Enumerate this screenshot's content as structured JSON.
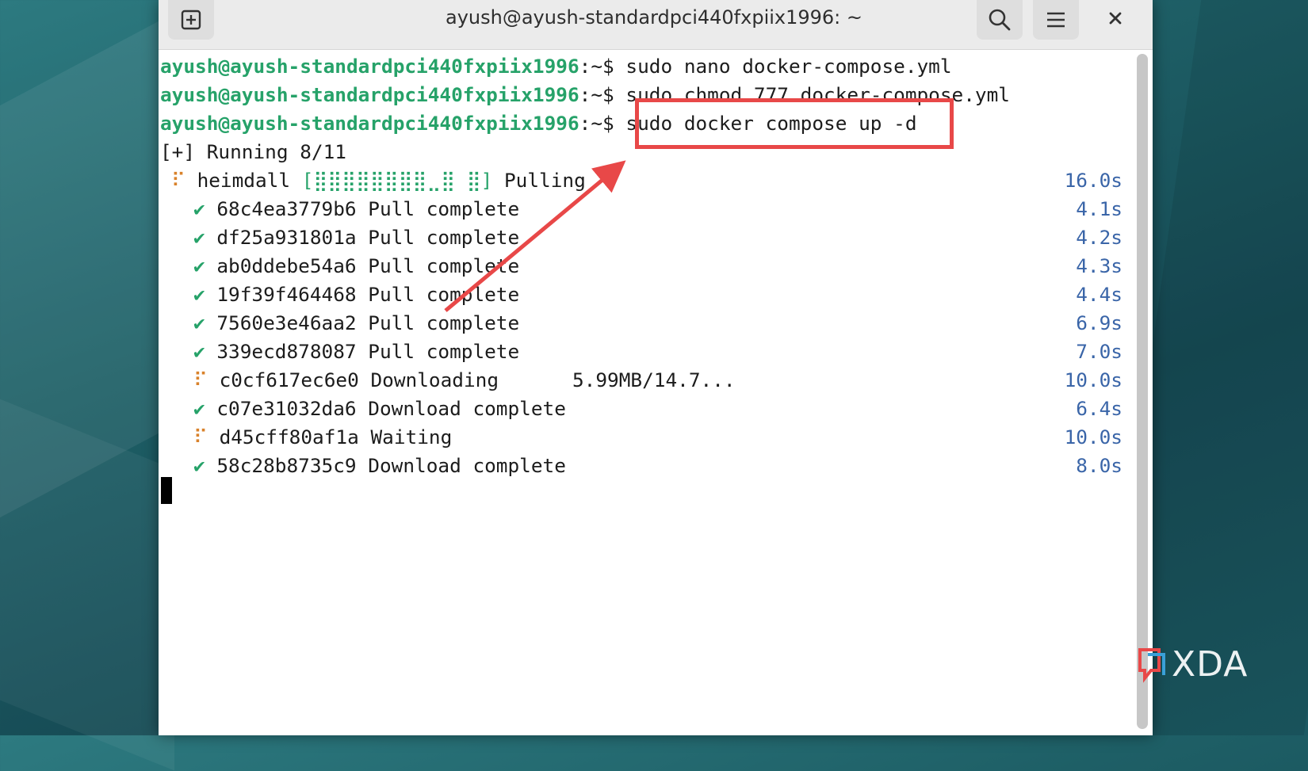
{
  "window": {
    "title": "ayush@ayush-standardpci440fxpiix1996: ~"
  },
  "terminal": {
    "prompt_user": "ayush@ayush-standardpci440fxpiix1996",
    "prompt_suffix": ":~$",
    "commands": [
      "sudo nano docker-compose.yml",
      "sudo chmod 777 docker-compose.yml",
      "sudo docker compose up -d"
    ],
    "running_status": "[+] Running 8/11",
    "service": {
      "spinner": "⠏",
      "name": "heimdall",
      "progress": "[⣿⣿⣿⣿⣿⣿⣿⣿⣀⣿ ⣿]",
      "status": "Pulling",
      "time": "16.0s"
    },
    "layers": [
      {
        "mark": "✔",
        "id": "68c4ea3779b6",
        "status": "Pull complete",
        "detail": "",
        "time": "4.1s",
        "state": "done"
      },
      {
        "mark": "✔",
        "id": "df25a931801a",
        "status": "Pull complete",
        "detail": "",
        "time": "4.2s",
        "state": "done"
      },
      {
        "mark": "✔",
        "id": "ab0ddebe54a6",
        "status": "Pull complete",
        "detail": "",
        "time": "4.3s",
        "state": "done"
      },
      {
        "mark": "✔",
        "id": "19f39f464468",
        "status": "Pull complete",
        "detail": "",
        "time": "4.4s",
        "state": "done"
      },
      {
        "mark": "✔",
        "id": "7560e3e46aa2",
        "status": "Pull complete",
        "detail": "",
        "time": "6.9s",
        "state": "done"
      },
      {
        "mark": "✔",
        "id": "339ecd878087",
        "status": "Pull complete",
        "detail": "",
        "time": "7.0s",
        "state": "done"
      },
      {
        "mark": "⠏",
        "id": "c0cf617ec6e0",
        "status": "Downloading",
        "detail": "5.99MB/14.7...",
        "time": "10.0s",
        "state": "busy"
      },
      {
        "mark": "✔",
        "id": "c07e31032da6",
        "status": "Download complete",
        "detail": "",
        "time": "6.4s",
        "state": "done"
      },
      {
        "mark": "⠏",
        "id": "d45cff80af1a",
        "status": "Waiting",
        "detail": "",
        "time": "10.0s",
        "state": "busy"
      },
      {
        "mark": "✔",
        "id": "58c28b8735c9",
        "status": "Download complete",
        "detail": "",
        "time": "8.0s",
        "state": "done"
      }
    ]
  },
  "watermark": {
    "text": "XDA"
  },
  "icons": {
    "new_tab": "new-tab-icon",
    "search": "search-icon",
    "menu": "hamburger-menu-icon",
    "close": "close-icon"
  },
  "colors": {
    "prompt": "#26a269",
    "time": "#3a65a8",
    "annotation": "#e84848",
    "spinner": "#d9822b"
  }
}
